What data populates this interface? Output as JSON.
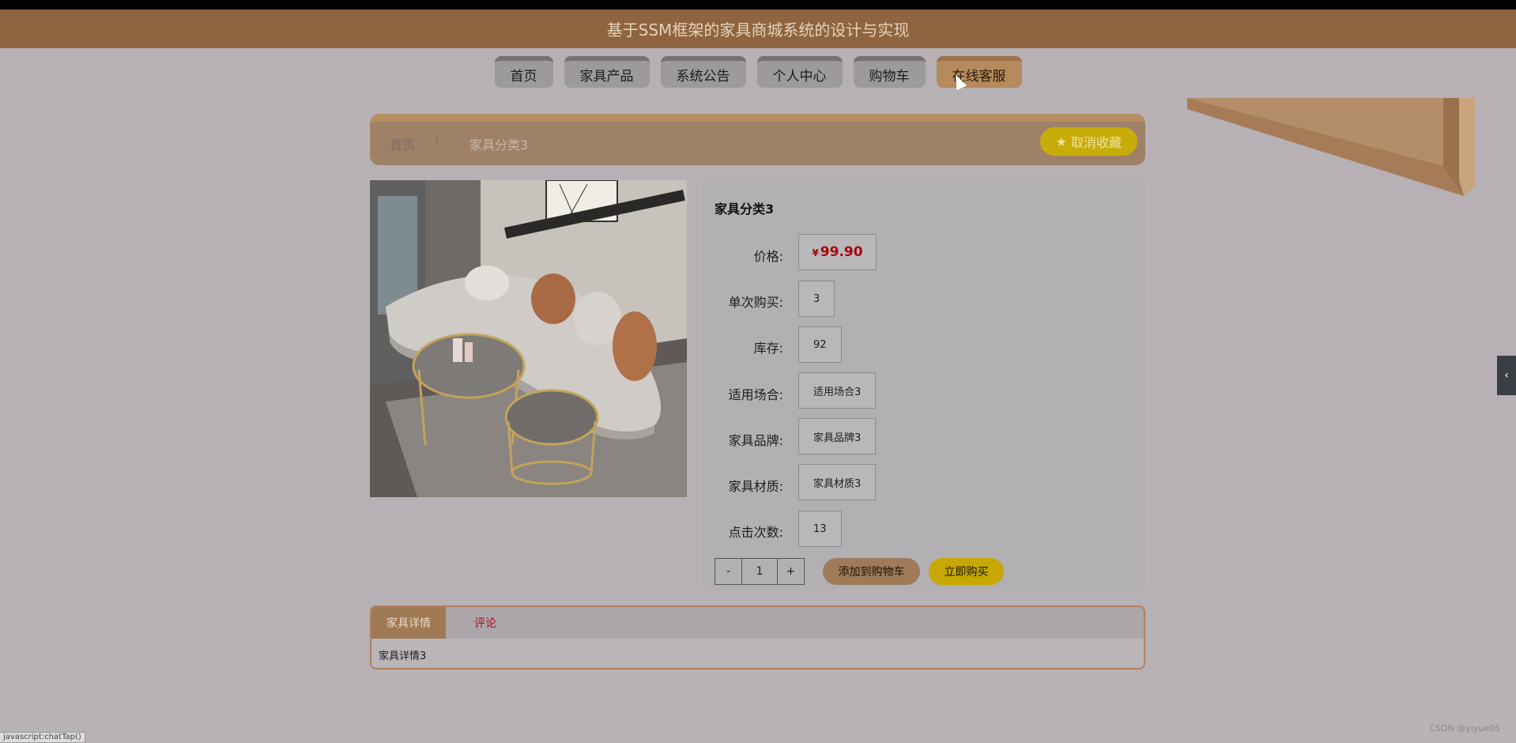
{
  "header": {
    "title": "基于SSM框架的家具商城系统的设计与实现"
  },
  "nav": {
    "items": [
      "首页",
      "家具产品",
      "系统公告",
      "个人中心",
      "购物车",
      "在线客服"
    ],
    "active_index": 5
  },
  "breadcrumb": {
    "home": "首页",
    "separator": "/",
    "current": "家具分类3"
  },
  "favorite_button": "取消收藏",
  "product": {
    "name": "家具分类3",
    "price_symbol": "¥",
    "price": "99.90",
    "rows": [
      {
        "label": "单次购买:",
        "value": "3"
      },
      {
        "label": "库存:",
        "value": "92"
      },
      {
        "label": "适用场合:",
        "value": "适用场合3"
      },
      {
        "label": "家具品牌:",
        "value": "家具品牌3"
      },
      {
        "label": "家具材质:",
        "value": "家具材质3"
      },
      {
        "label": "点击次数:",
        "value": "13"
      }
    ],
    "price_label": "价格:"
  },
  "stepper": {
    "minus": "-",
    "qty": "1",
    "plus": "+"
  },
  "actions": {
    "add_to_cart": "添加到购物车",
    "buy_now": "立即购买"
  },
  "tabs": {
    "items": [
      "家具详情",
      "评论"
    ],
    "active_index": 0,
    "content": "家具详情3"
  },
  "status_tip": "javascript:chatTap()",
  "watermark": "CSDN @yiyue05",
  "colors": {
    "header_bg": "#8e6540",
    "accent_gold": "#c8ad0a",
    "price_red": "#a8050d"
  }
}
